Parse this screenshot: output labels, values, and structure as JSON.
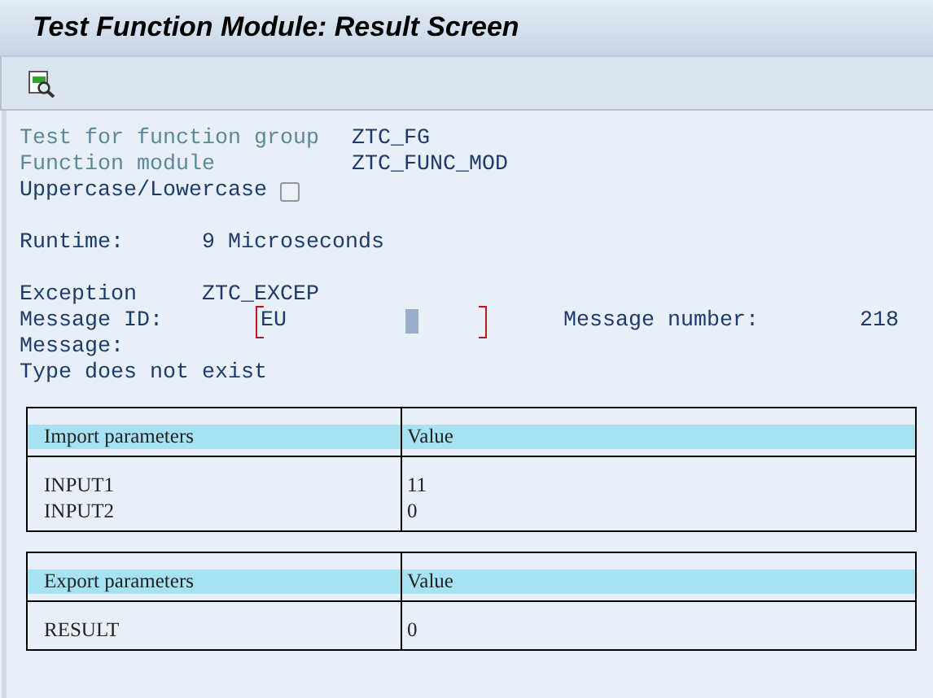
{
  "window": {
    "title": "Test Function Module: Result Screen"
  },
  "header_fields": [
    {
      "label": "Test for function group",
      "value": "ZTC_FG"
    },
    {
      "label": "Function module",
      "value": "ZTC_FUNC_MOD"
    }
  ],
  "case_option": {
    "label": "Uppercase/Lowercase",
    "checked": false
  },
  "runtime": {
    "label": "Runtime:",
    "value": "9 Microseconds"
  },
  "exception": {
    "label": "Exception",
    "value": "ZTC_EXCEP"
  },
  "message_id": {
    "label": "Message ID:",
    "value": "EU"
  },
  "message_number": {
    "label": "Message number:",
    "value": "218"
  },
  "message": {
    "label": "Message:",
    "text": "Type does not exist"
  },
  "tables": [
    {
      "columns": [
        "Import parameters",
        "Value"
      ],
      "rows": [
        [
          "INPUT1",
          "11"
        ],
        [
          "INPUT2",
          "0"
        ]
      ]
    },
    {
      "columns": [
        "Export parameters",
        "Value"
      ],
      "rows": [
        [
          "RESULT",
          "0"
        ]
      ]
    }
  ]
}
